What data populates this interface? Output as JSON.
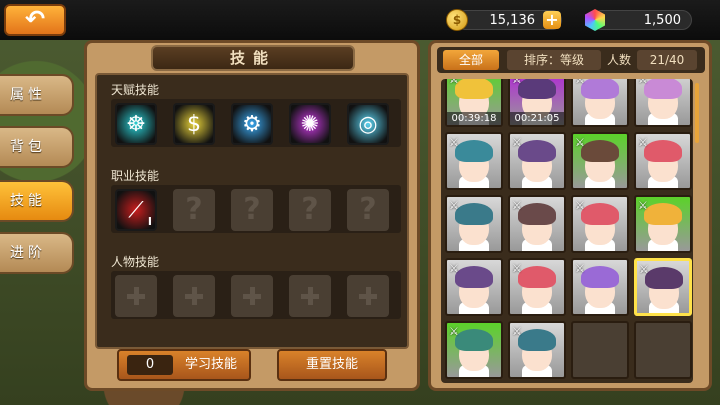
{
  "header": {
    "back_label": "↶",
    "gold": "15,136",
    "gold_plus": "+",
    "gems": "1,500"
  },
  "sidebar": {
    "tabs": [
      {
        "label": "属性"
      },
      {
        "label": "背包"
      },
      {
        "label": "技能",
        "active": true
      },
      {
        "label": "进阶"
      }
    ]
  },
  "skills_panel": {
    "title": "技能",
    "talent_label": "天赋技能",
    "class_label": "职业技能",
    "char_label": "人物技能",
    "talent_skills": [
      {
        "icon": "brain-icon",
        "glyph": "☸",
        "color": "#2ad0d6"
      },
      {
        "icon": "dollar-coin-icon",
        "glyph": "$",
        "color": "#e8d23a"
      },
      {
        "icon": "gear-shield-icon",
        "glyph": "⚙",
        "color": "#3aa8f0"
      },
      {
        "icon": "purple-burst-icon",
        "glyph": "✺",
        "color": "#c83adf"
      },
      {
        "icon": "book-glasses-icon",
        "glyph": "◎",
        "color": "#5ad2f0"
      }
    ],
    "class_skills": [
      {
        "icon": "slash-skill-icon",
        "glyph": "⟋",
        "color": "#c81e1e",
        "level": "I"
      },
      {
        "empty": true,
        "glyph": "?"
      },
      {
        "empty": true,
        "glyph": "?"
      },
      {
        "empty": true,
        "glyph": "?"
      },
      {
        "empty": true,
        "glyph": "?"
      }
    ],
    "learn_count": "0",
    "learn_label": "学习技能",
    "reset_label": "重置技能"
  },
  "roster": {
    "filter_all": "全部",
    "sort_label": "排序：等级",
    "count_label": "人数",
    "count_value": "21/40",
    "cards": [
      {
        "bg": "#5bd22a",
        "hair": "#f0c23a",
        "timer": "00:39:18"
      },
      {
        "bg": "#b228d6",
        "hair": "#5a3a7a",
        "timer": "00:21:05"
      },
      {
        "bg": "#d8d8d8",
        "hair": "#b07ad8"
      },
      {
        "bg": "#d8d8d8",
        "hair": "#c98ad6"
      },
      {
        "bg": "#d8d8d8",
        "hair": "#3a8a9a"
      },
      {
        "bg": "#d8d8d8",
        "hair": "#6a4a8a"
      },
      {
        "bg": "#5bd22a",
        "hair": "#6a4a3a"
      },
      {
        "bg": "#d8d8d8",
        "hair": "#e05a6a"
      },
      {
        "bg": "#d8d8d8",
        "hair": "#3a7a8a"
      },
      {
        "bg": "#d8d8d8",
        "hair": "#6a4a4a"
      },
      {
        "bg": "#d8d8d8",
        "hair": "#e05a6a"
      },
      {
        "bg": "#5bd22a",
        "hair": "#f0b23a"
      },
      {
        "bg": "#d8d8d8",
        "hair": "#6a4a8a"
      },
      {
        "bg": "#d8d8d8",
        "hair": "#e05a6a"
      },
      {
        "bg": "#d8d8d8",
        "hair": "#9a6ad6"
      },
      {
        "bg": "#d8d8d8",
        "hair": "#5a3a6a",
        "selected": true
      },
      {
        "bg": "#5bd22a",
        "hair": "#3a8a7a"
      },
      {
        "bg": "#d8d8d8",
        "hair": "#3a7a8a"
      },
      {
        "empty": true
      },
      {
        "empty": true
      }
    ]
  }
}
